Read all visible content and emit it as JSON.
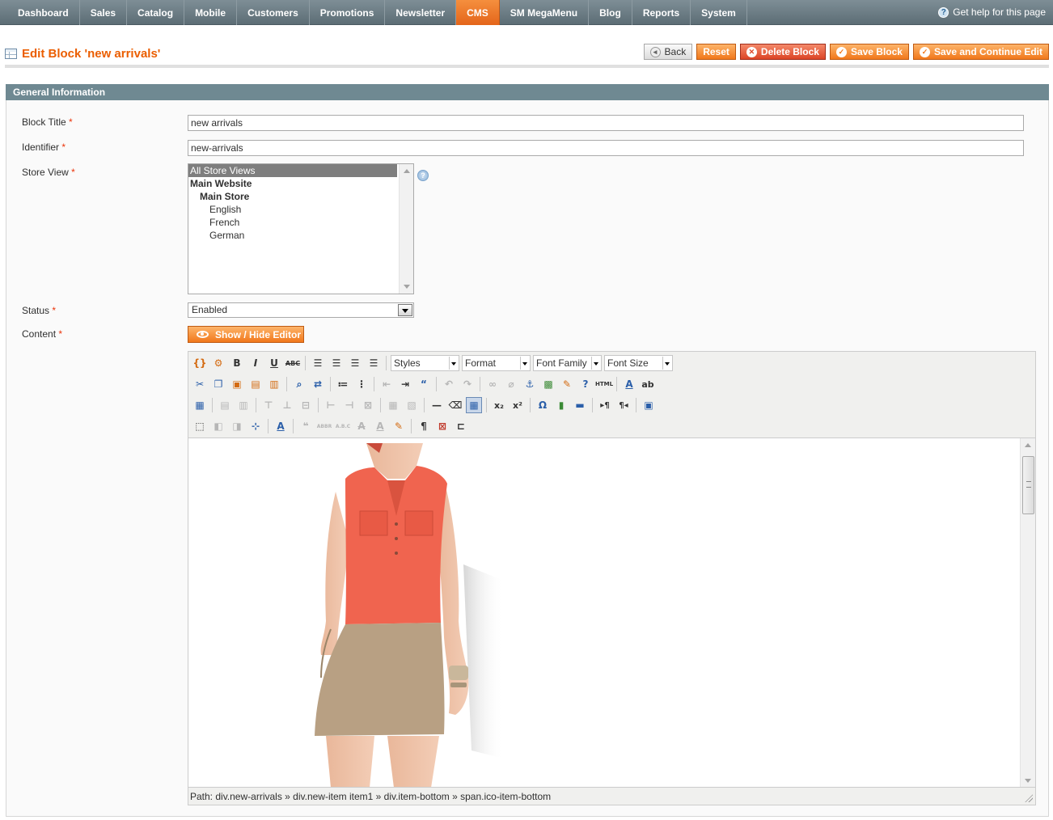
{
  "nav": {
    "items": [
      "Dashboard",
      "Sales",
      "Catalog",
      "Mobile",
      "Customers",
      "Promotions",
      "Newsletter",
      "CMS",
      "SM MegaMenu",
      "Blog",
      "Reports",
      "System"
    ],
    "active": "CMS",
    "help": "Get help for this page"
  },
  "header": {
    "title": "Edit Block 'new arrivals'",
    "buttons": {
      "back": "Back",
      "reset": "Reset",
      "delete": "Delete Block",
      "save": "Save Block",
      "save_continue": "Save and Continue Edit"
    }
  },
  "section": {
    "title": "General Information"
  },
  "form": {
    "block_title": {
      "label": "Block Title",
      "value": "new arrivals"
    },
    "identifier": {
      "label": "Identifier",
      "value": "new-arrivals"
    },
    "store_view": {
      "label": "Store View",
      "options": [
        "All Store Views",
        "Main Website",
        "Main Store",
        "English",
        "French",
        "German"
      ],
      "selected": "All Store Views"
    },
    "status": {
      "label": "Status",
      "value": "Enabled"
    },
    "content": {
      "label": "Content",
      "toggle": "Show / Hide Editor"
    },
    "required_mark": "*"
  },
  "editor": {
    "dropdowns": {
      "styles": "Styles",
      "format": "Format",
      "font_family": "Font Family",
      "font_size": "Font Size"
    },
    "path": "Path: div.new-arrivals » div.new-item item1 » div.item-bottom » span.ico-item-bottom"
  },
  "colors": {
    "accent": "#eb5e00",
    "nav": "#6f828b",
    "section": "#6f8992",
    "button": "#f1781b"
  }
}
